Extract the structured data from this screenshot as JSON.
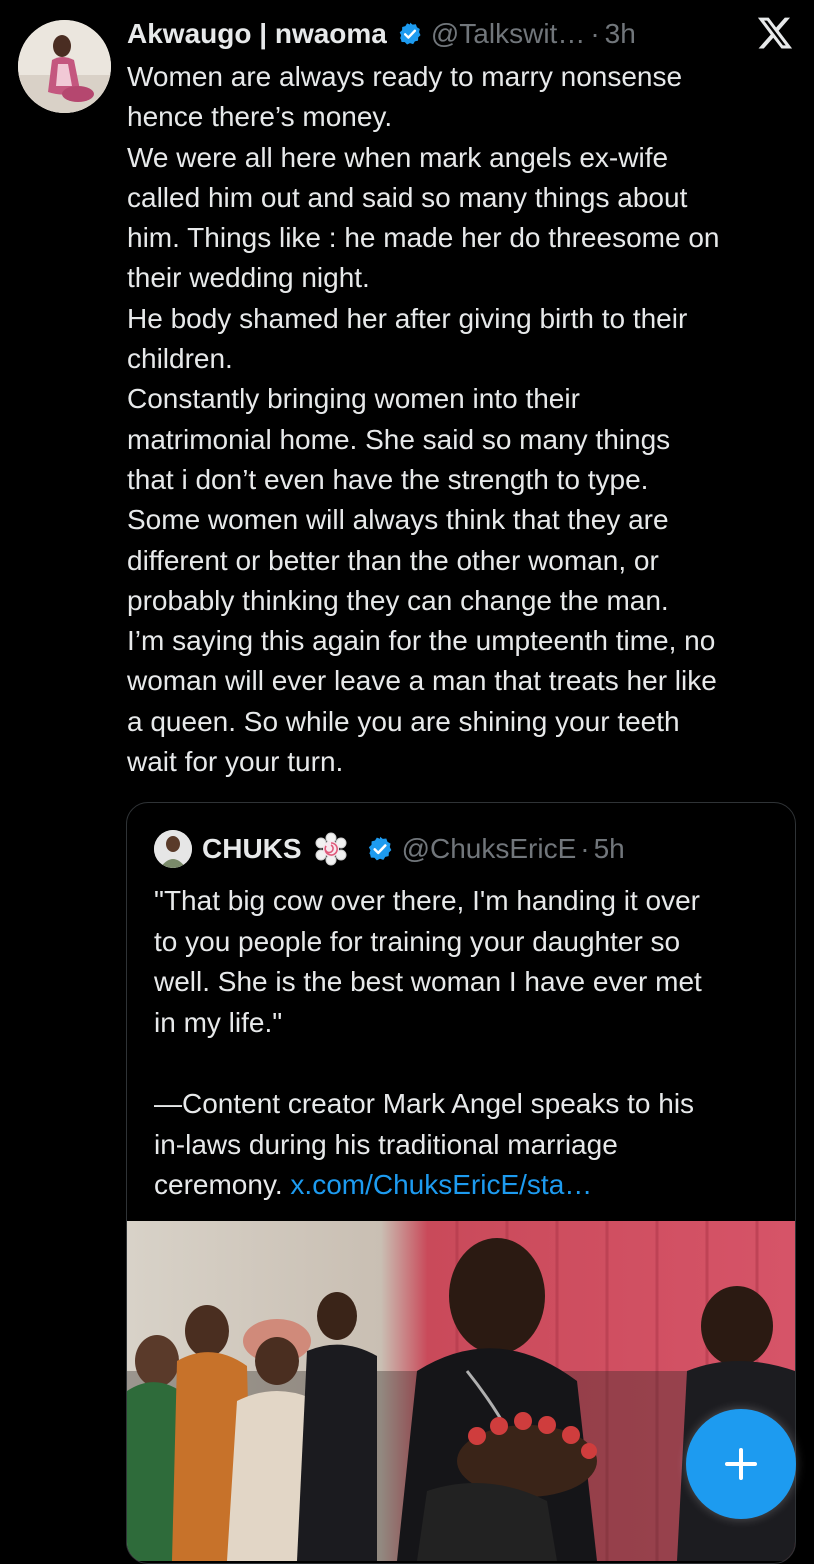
{
  "post": {
    "author_name": "Akwaugo | nwaoma",
    "handle": "@Talkswit…",
    "separator": "·",
    "time": "3h",
    "text": "Women are always ready to marry nonsense\nhence there’s money.\nWe were all here when mark angels ex-wife\ncalled him out and said so many things about\nhim. Things like : he made her do threesome on\ntheir wedding night.\nHe body shamed her after giving birth to their\nchildren.\nConstantly bringing women into their\nmatrimonial home. She said so many things\nthat i don’t even have the strength to type.\nSome women will always think that they are\ndifferent or better than the other woman, or\nprobably thinking they can change the man.\nI’m saying this again for the umpteenth time, no\nwoman will ever leave a man that treats her like\na queen. So while you are shining your teeth\nwait for your turn."
  },
  "quote": {
    "author_name": "CHUKS",
    "handle": "@ChuksEricE",
    "separator": "·",
    "time": "5h",
    "text": "\"That big cow over there, I'm handing it over\nto you people for training your daughter so\nwell. She is the best woman I have ever met\nin my life.\"\n\n—Content creator Mark Angel speaks to his\nin-laws during his traditional marriage\nceremony. ",
    "link_text": "x.com/ChuksEricE/sta…"
  },
  "icons": {
    "verified": "verified-badge-icon",
    "close": "x-logo-icon",
    "compose": "plus-icon"
  },
  "colors": {
    "background": "#000000",
    "text": "#e7e9ea",
    "muted": "#71767b",
    "accent": "#1d9bf0"
  }
}
